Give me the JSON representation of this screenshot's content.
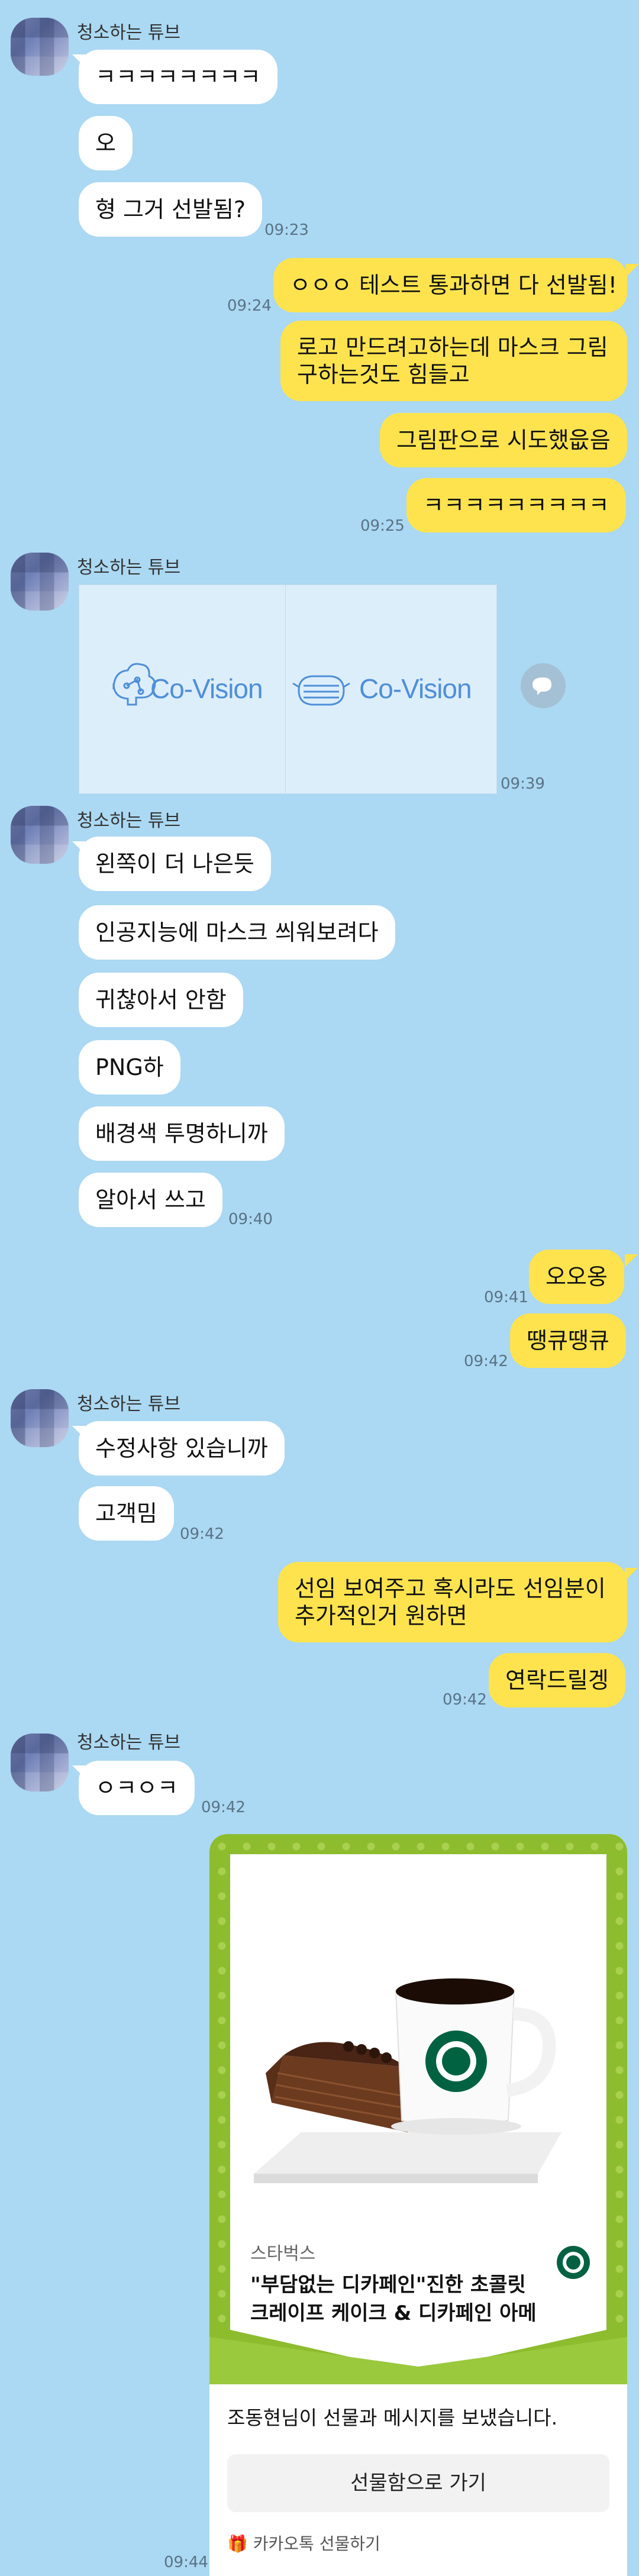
{
  "sender": "청소하는 튜브",
  "messages": {
    "m1": "ㅋㅋㅋㅋㅋㅋㅋㅋ",
    "m2": "오",
    "m3": "형 그거 선발됨?",
    "t1": "09:23",
    "o1": "ㅇㅇㅇ 테스트 통과하면 다 선발됨!",
    "t2": "09:24",
    "o2": "로고 만드려고하는데 마스크 그림 구하는것도 힘들고",
    "o3": "그림판으로 시도했읎음",
    "o4": "ㅋㅋㅋㅋㅋㅋㅋㅋㅋ",
    "t3": "09:25",
    "logo_text_1": "Co-Vision",
    "logo_text_2": "Co-Vision",
    "t4": "09:39",
    "m4": "왼쪽이 더 나은듯",
    "m5": "인공지능에 마스크 씌워보려다",
    "m6": "귀찮아서 안함",
    "m7": "PNG하",
    "m8": "배경색 투명하니까",
    "m9": "알아서 쓰고",
    "t5": "09:40",
    "o5": "오오옹",
    "t6": "09:41",
    "o6": "땡큐땡큐",
    "t7": "09:42",
    "m10": "수정사항 있습니까",
    "m11": "고객밈",
    "t8": "09:42",
    "o7": "선임 보여주고 혹시라도 선임분이 추가적인거 원하면",
    "o8": "연락드릴겡",
    "t9": "09:42",
    "m12": "ㅇㅋㅇㅋ",
    "t10": "09:42",
    "t11": "09:44"
  },
  "gift": {
    "brand": "스타벅스",
    "product_line1": "\"부담없는 디카페인\"진한 초콜릿",
    "product_line2": "크레이프 케이크 & 디카페인 아메",
    "message": "조동현님이 선물과 메시지를 보냈습니다.",
    "button": "선물함으로 가기",
    "footer": "카카오톡 선물하기"
  },
  "colors": {
    "background": "#abd8f2",
    "out_bubble": "#fee34e",
    "in_bubble": "#ffffff",
    "gift_green": "#8dbc2e",
    "logo_blue": "#4f8fd8"
  }
}
